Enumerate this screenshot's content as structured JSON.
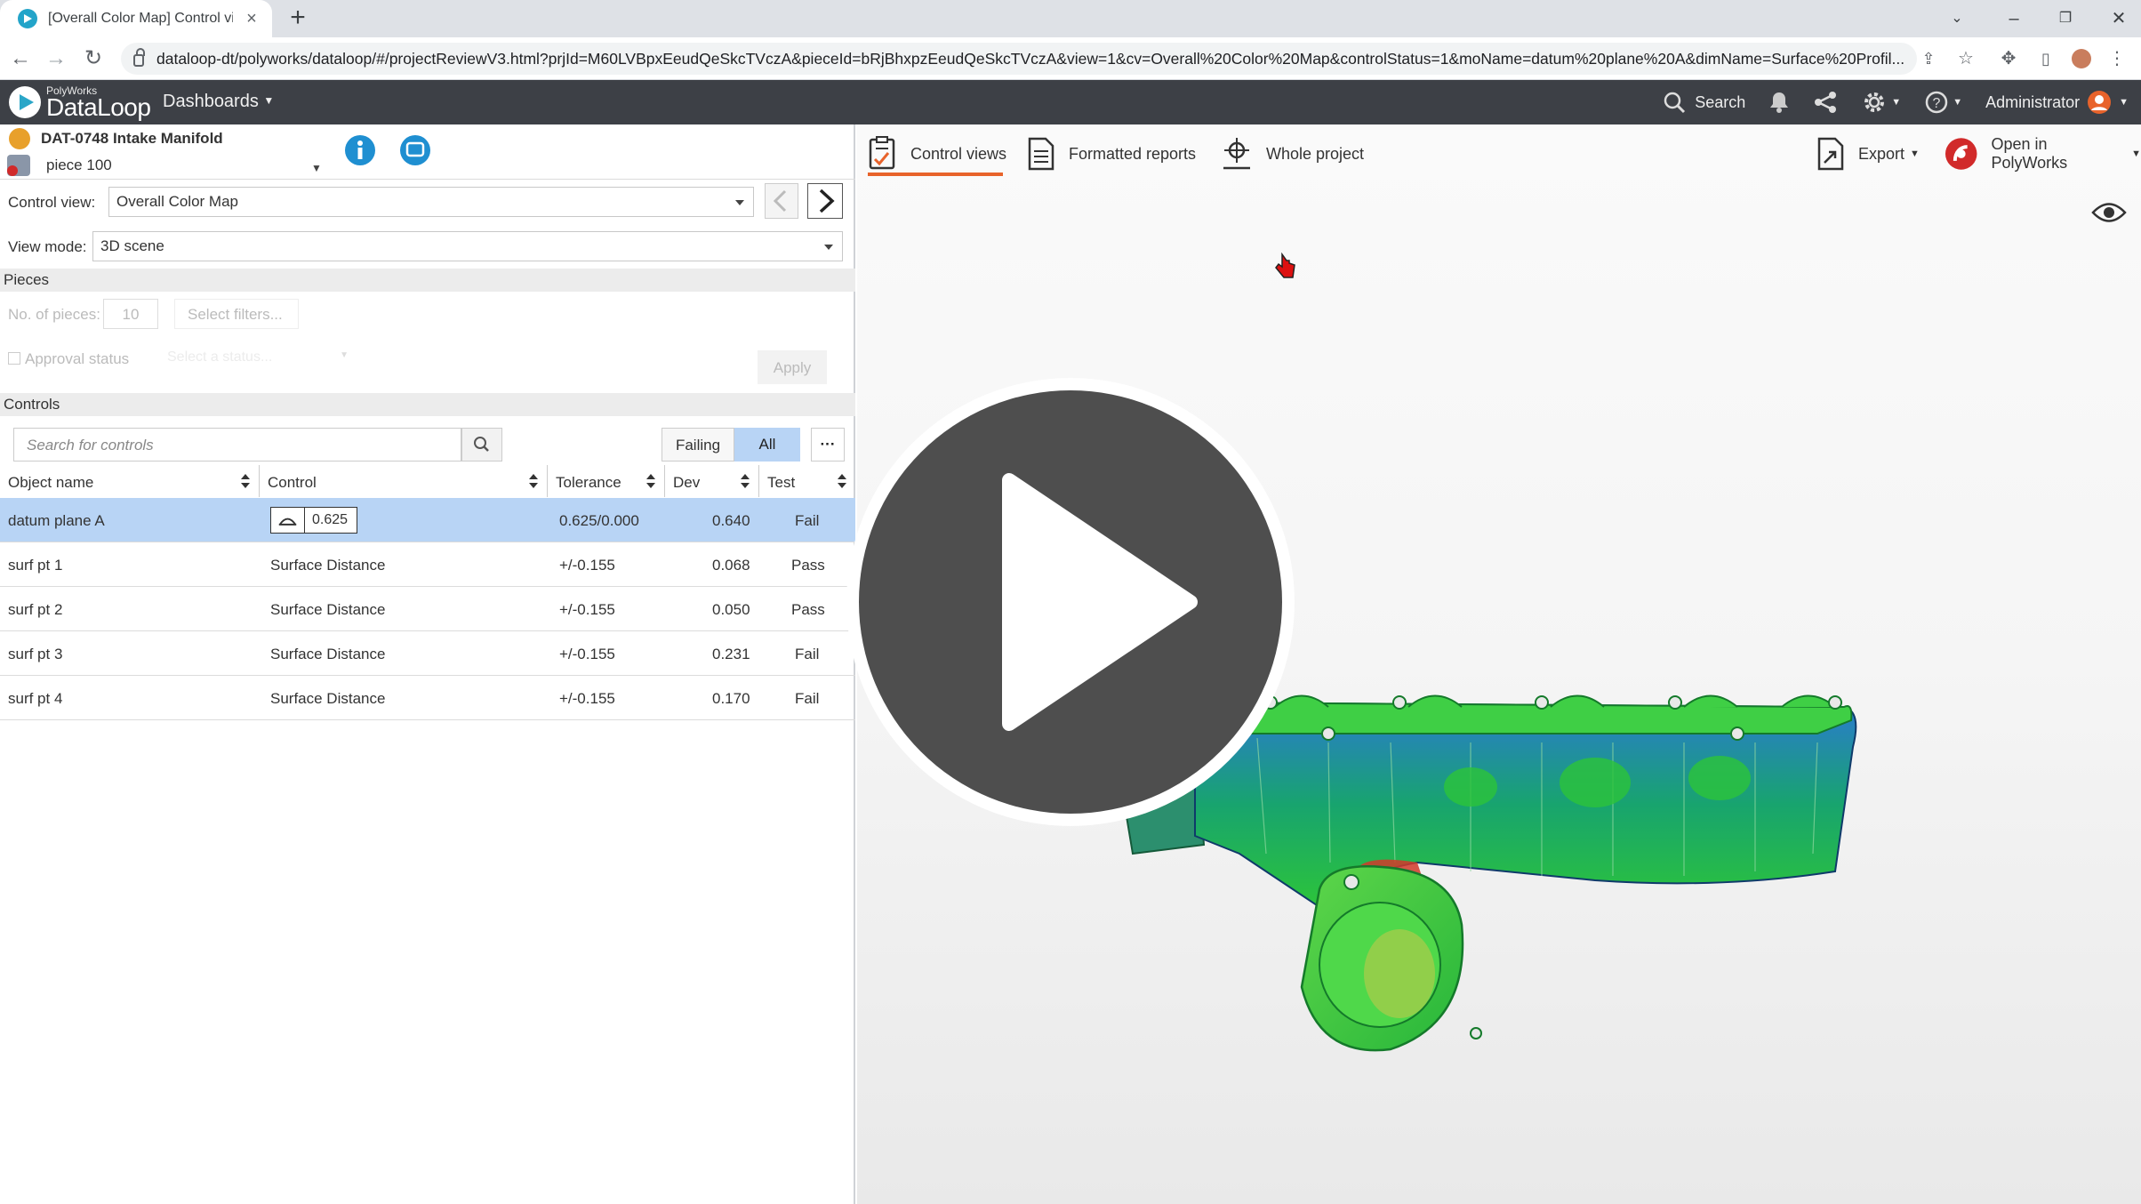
{
  "browser": {
    "tab_title": "[Overall Color Map] Control view",
    "tab_close": "×",
    "new_tab": "+",
    "url": "dataloop-dt/polyworks/dataloop/#/projectReviewV3.html?prjId=M60LVBpxEeudQeSkcTVczA&pieceId=bRjBhxpzEeudQeSkcTVczA&view=1&cv=Overall%20Color%20Map&controlStatus=1&moName=datum%20plane%20A&dimName=Surface%20Profil..."
  },
  "app": {
    "brand_top": "PolyWorks",
    "brand_name": "DataLoop",
    "dashboards_label": "Dashboards",
    "search_label": "Search",
    "user_label": "Administrator"
  },
  "project": {
    "name": "DAT-0748 Intake Manifold",
    "piece": "piece 100"
  },
  "control_view": {
    "label": "Control view:",
    "value": "Overall Color Map"
  },
  "view_mode": {
    "label": "View mode:",
    "value": "3D scene"
  },
  "pieces": {
    "section": "Pieces",
    "count_label": "No. of pieces:",
    "count_value": "10",
    "filters_placeholder": "Select filters...",
    "approval_label": "Approval status",
    "approval_placeholder": "Select a status...",
    "apply_label": "Apply"
  },
  "controls": {
    "section": "Controls",
    "search_placeholder": "Search for controls",
    "failing_label": "Failing",
    "all_label": "All",
    "more_label": "···",
    "columns": [
      "Object name",
      "Control",
      "Tolerance",
      "Dev",
      "Test"
    ],
    "rows": [
      {
        "object": "datum plane A",
        "control": "0.625",
        "tolerance": "0.625/0.000",
        "dev": "0.640",
        "test": "Fail"
      },
      {
        "object": "surf pt 1",
        "control": "Surface Distance",
        "tolerance": "+/-0.155",
        "dev": "0.068",
        "test": "Pass"
      },
      {
        "object": "surf pt 2",
        "control": "Surface Distance",
        "tolerance": "+/-0.155",
        "dev": "0.050",
        "test": "Pass"
      },
      {
        "object": "surf pt 3",
        "control": "Surface Distance",
        "tolerance": "+/-0.155",
        "dev": "0.231",
        "test": "Fail"
      },
      {
        "object": "surf pt 4",
        "control": "Surface Distance",
        "tolerance": "+/-0.155",
        "dev": "0.170",
        "test": "Fail"
      }
    ]
  },
  "view_tabs": {
    "control_views": "Control views",
    "formatted_reports": "Formatted reports",
    "whole_project": "Whole project",
    "export": "Export",
    "open_polyworks": "Open in PolyWorks"
  },
  "colors": {
    "header_bg": "#3d4046",
    "accent": "#e8632b",
    "selected_row": "#b8d4f5",
    "info_blue": "#1f8fd1",
    "part_green": "#2fbf2a",
    "play_overlay": "#444444"
  }
}
